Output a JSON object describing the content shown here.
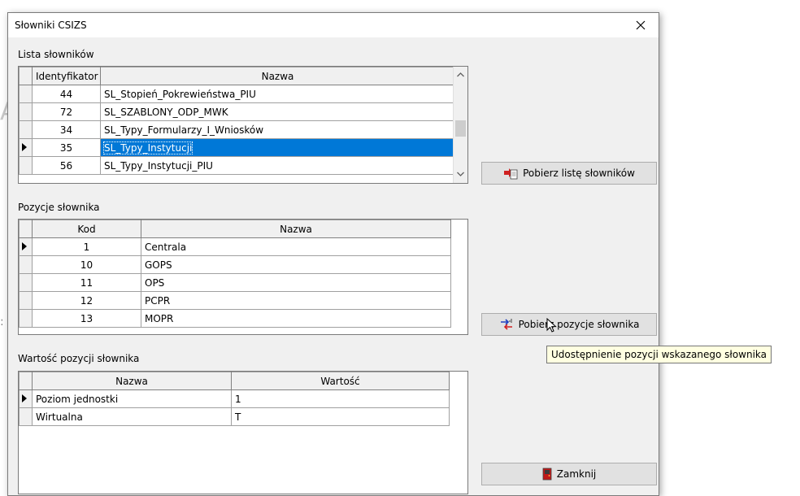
{
  "window": {
    "title": "Słowniki CSIZS"
  },
  "dictionary_list": {
    "label": "Lista słowników",
    "columns": [
      "Identyfikator",
      "Nazwa"
    ],
    "rows": [
      [
        "44",
        "SL_Stopień_Pokrewieństwa_PIU"
      ],
      [
        "72",
        "SL_SZABLONY_ODP_MWK"
      ],
      [
        "34",
        "SL_Typy_Formularzy_I_Wniosków"
      ],
      [
        "35",
        "SL_Typy_Instytucji"
      ],
      [
        "56",
        "SL_Typy_Instytucji_PIU"
      ]
    ],
    "selected_index": 3
  },
  "dictionary_items": {
    "label": "Pozycje słownika",
    "columns": [
      "Kod",
      "Nazwa"
    ],
    "rows": [
      [
        "1",
        "Centrala"
      ],
      [
        "10",
        "GOPS"
      ],
      [
        "11",
        "OPS"
      ],
      [
        "12",
        "PCPR"
      ],
      [
        "13",
        "MOPR"
      ]
    ],
    "selected_index": 0
  },
  "item_values": {
    "label": "Wartość pozycji słownika",
    "columns": [
      "Nazwa",
      "Wartość"
    ],
    "rows": [
      [
        "Poziom jednostki",
        "1"
      ],
      [
        "Wirtualna",
        "T"
      ]
    ],
    "selected_index": 0
  },
  "buttons": {
    "fetch_list": "Pobierz listę słowników",
    "fetch_items": "Pobierz pozycje słownika",
    "close": "Zamknij"
  },
  "tooltip": "Udostępnienie pozycji wskazanego słownika",
  "icons": {
    "close": "close-x",
    "fetch_list": "red-arrow-document",
    "fetch_items": "red-blue-arrows",
    "exit": "door"
  },
  "colors": {
    "selection": "#0078d7",
    "tooltip_bg": "#ffffe1",
    "icon_red": "#d02020"
  }
}
